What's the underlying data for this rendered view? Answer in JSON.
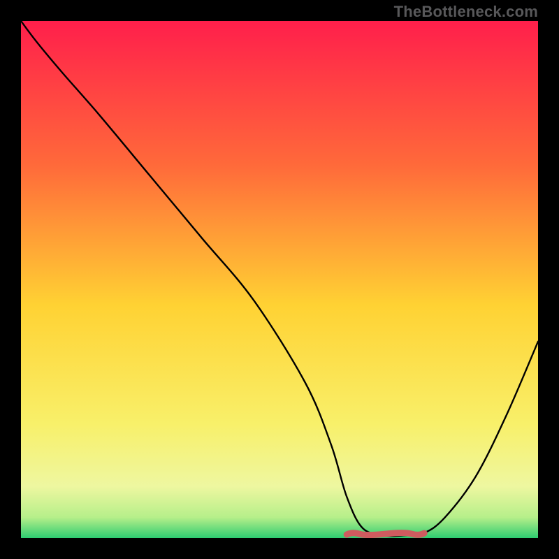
{
  "attribution": "TheBottleneck.com",
  "colors": {
    "top": "#ff1f4b",
    "mid_upper": "#ff7a3a",
    "mid": "#ffd233",
    "mid_lower": "#f8f06a",
    "green_light": "#d6f58a",
    "green": "#2ecc71",
    "background": "#000000",
    "curve": "#000000",
    "marker": "#cf5b5f"
  },
  "chart_data": {
    "type": "line",
    "title": "",
    "xlabel": "",
    "ylabel": "",
    "xlim": [
      0,
      100
    ],
    "ylim": [
      0,
      100
    ],
    "curve": {
      "x": [
        0,
        3,
        8,
        15,
        25,
        35,
        45,
        55,
        60,
        63,
        66,
        70,
        74,
        78,
        82,
        88,
        94,
        100
      ],
      "y": [
        100,
        96,
        90,
        82,
        70,
        58,
        46,
        30,
        18,
        8,
        2,
        0.5,
        0.5,
        1,
        4,
        12,
        24,
        38
      ]
    },
    "plateau": {
      "x_start": 63,
      "x_end": 78,
      "y": 0.8
    },
    "green_band": {
      "y_top": 6,
      "y_bottom": 0
    },
    "annotations": []
  }
}
